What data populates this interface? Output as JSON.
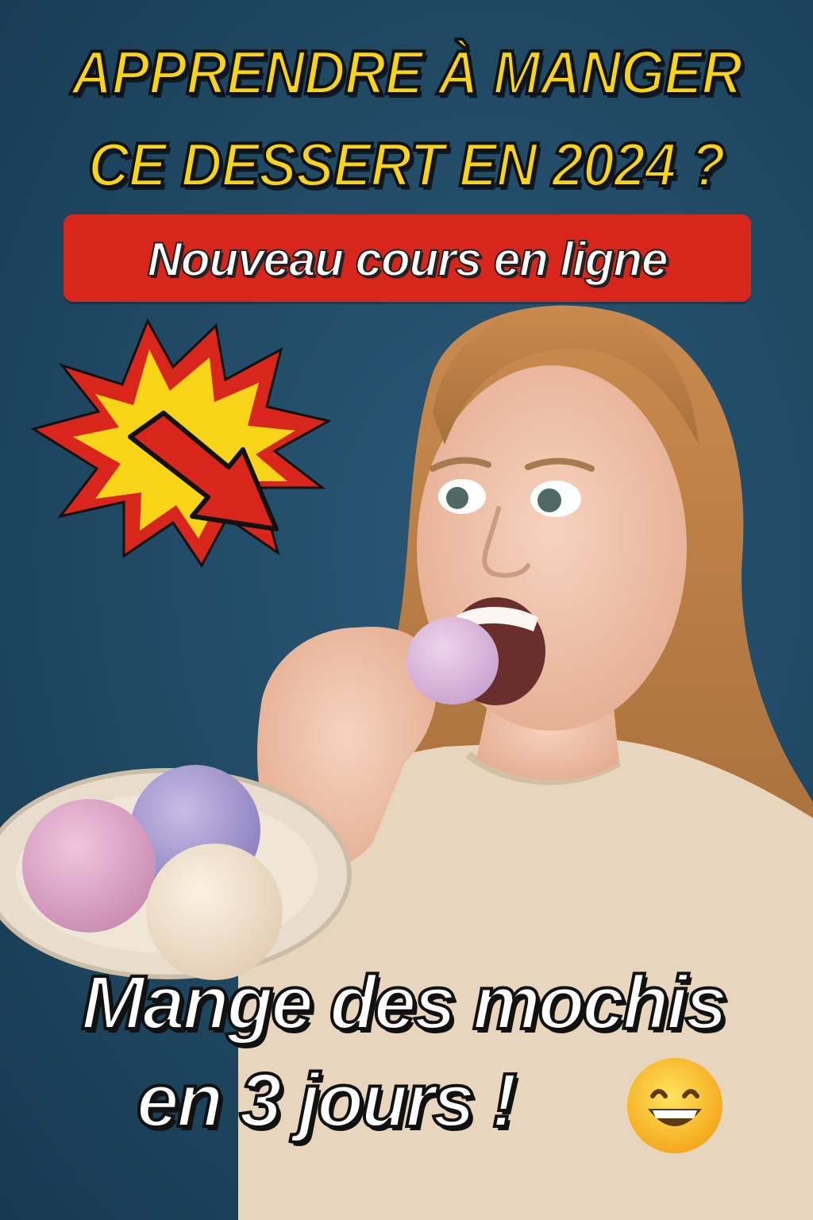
{
  "headline": {
    "line1": "APPRENDRE À MANGER",
    "line2": "CE DESSERT EN 2024 ?"
  },
  "banner": {
    "text": "Nouveau cours en ligne",
    "color": "#d8261c"
  },
  "cta": {
    "line1": "Mange des mochis",
    "line2": "en 3 jours !"
  },
  "colors": {
    "background": "#1f4862",
    "headline": "#f7d417",
    "burst_outer": "#d8261c",
    "burst_inner": "#f7d417",
    "arrow": "#d8261c"
  },
  "icons": {
    "burst": "explosion-burst",
    "arrow": "arrow-down-right",
    "emoji": "grinning-face-with-smiling-eyes"
  }
}
